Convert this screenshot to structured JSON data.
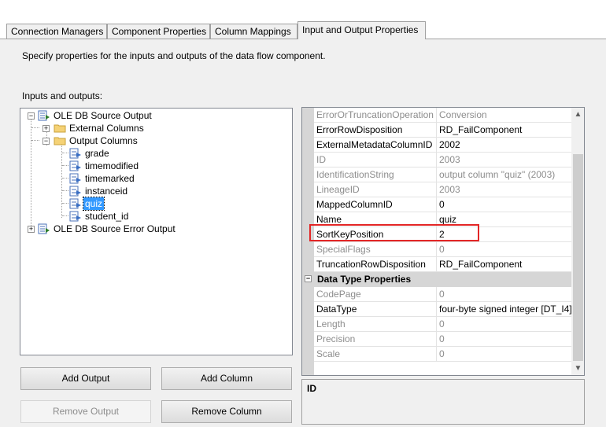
{
  "tabs": [
    {
      "label": "Connection Managers"
    },
    {
      "label": "Component Properties"
    },
    {
      "label": "Column Mappings"
    },
    {
      "label": "Input and Output Properties"
    }
  ],
  "description": "Specify properties for the inputs and outputs of the data flow component.",
  "io_label": "Inputs and outputs:",
  "tree": {
    "root_output": "OLE DB Source Output",
    "external_columns": "External Columns",
    "output_columns": "Output Columns",
    "columns": [
      "grade",
      "timemodified",
      "timemarked",
      "instanceid",
      "quiz",
      "student_id"
    ],
    "selected_column": "quiz",
    "error_output": "OLE DB Source Error Output"
  },
  "buttons": {
    "add_output": "Add Output",
    "add_column": "Add Column",
    "remove_output": "Remove Output",
    "remove_column": "Remove Column"
  },
  "properties": [
    {
      "name": "ErrorOrTruncationOperation",
      "value": "Conversion",
      "readonly": true
    },
    {
      "name": "ErrorRowDisposition",
      "value": "RD_FailComponent",
      "readonly": false
    },
    {
      "name": "ExternalMetadataColumnID",
      "value": "2002",
      "readonly": false
    },
    {
      "name": "ID",
      "value": "2003",
      "readonly": true
    },
    {
      "name": "IdentificationString",
      "value": "output column \"quiz\" (2003)",
      "readonly": true
    },
    {
      "name": "LineageID",
      "value": "2003",
      "readonly": true
    },
    {
      "name": "MappedColumnID",
      "value": "0",
      "readonly": false
    },
    {
      "name": "Name",
      "value": "quiz",
      "readonly": false
    },
    {
      "name": "SortKeyPosition",
      "value": "2",
      "readonly": false
    },
    {
      "name": "SpecialFlags",
      "value": "0",
      "readonly": true
    },
    {
      "name": "TruncationRowDisposition",
      "value": "RD_FailComponent",
      "readonly": false
    }
  ],
  "category": "Data Type Properties",
  "datatype_properties": [
    {
      "name": "CodePage",
      "value": "0",
      "readonly": true
    },
    {
      "name": "DataType",
      "value": "four-byte signed integer [DT_I4]",
      "readonly": false
    },
    {
      "name": "Length",
      "value": "0",
      "readonly": true
    },
    {
      "name": "Precision",
      "value": "0",
      "readonly": true
    },
    {
      "name": "Scale",
      "value": "0",
      "readonly": true
    }
  ],
  "description_box_title": "ID",
  "colors": {
    "selection": "#3399ff",
    "highlight_border": "#e32626"
  }
}
